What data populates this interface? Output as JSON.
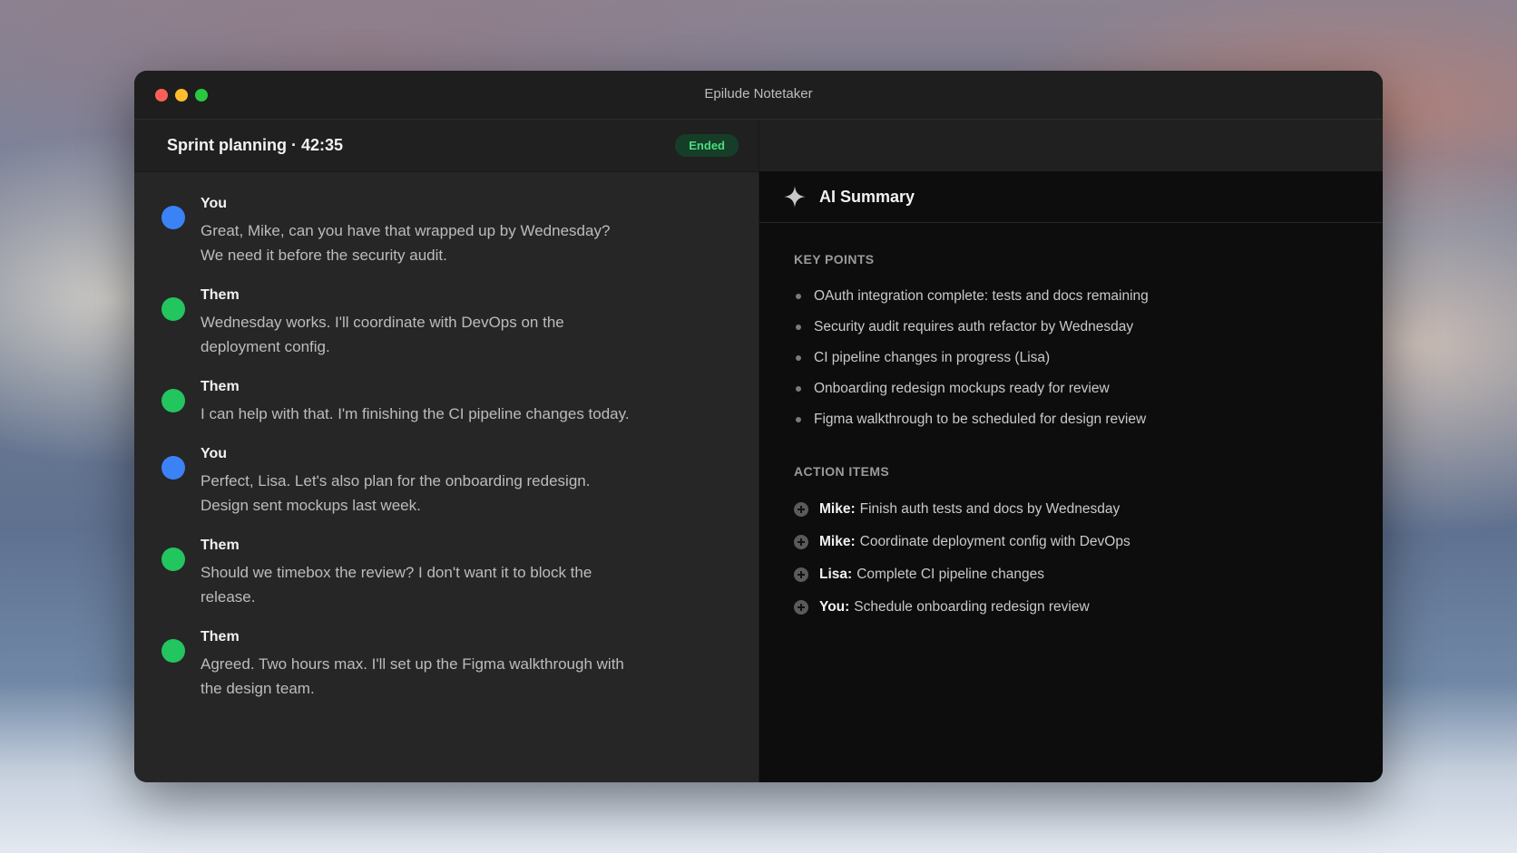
{
  "window": {
    "title": "Epilude Notetaker"
  },
  "session": {
    "title": "Sprint planning · 42:35",
    "status": "Ended",
    "status_color": "#4ade80"
  },
  "transcript": [
    {
      "speaker": "You",
      "avatar_color": "#3b82f6",
      "text": "Great, Mike, can you have that wrapped up by Wednesday? We need it before the security audit."
    },
    {
      "speaker": "Them",
      "avatar_color": "#22c55e",
      "text": "Wednesday works. I'll coordinate with DevOps on the deployment config."
    },
    {
      "speaker": "Them",
      "avatar_color": "#22c55e",
      "text": "I can help with that. I'm finishing the CI pipeline changes today."
    },
    {
      "speaker": "You",
      "avatar_color": "#3b82f6",
      "text": "Perfect, Lisa. Let's also plan for the onboarding redesign. Design sent mockups last week."
    },
    {
      "speaker": "Them",
      "avatar_color": "#22c55e",
      "text": "Should we timebox the review? I don't want it to block the release."
    },
    {
      "speaker": "Them",
      "avatar_color": "#22c55e",
      "text": "Agreed. Two hours max. I'll set up the Figma walkthrough with the design team."
    }
  ],
  "summary": {
    "title": "AI Summary",
    "icon": "sparkle-icon",
    "key_points_title": "KEY POINTS",
    "key_points": [
      "OAuth integration complete: tests and docs remaining",
      "Security audit requires auth refactor by Wednesday",
      "CI pipeline changes in progress (Lisa)",
      "Onboarding redesign mockups ready for review",
      "Figma walkthrough to be scheduled for design review"
    ],
    "action_items_title": "ACTION ITEMS",
    "action_items": [
      {
        "owner": "Mike:",
        "task": "Finish auth tests and docs by Wednesday"
      },
      {
        "owner": "Mike:",
        "task": "Coordinate deployment config with DevOps"
      },
      {
        "owner": "Lisa:",
        "task": "Complete CI pipeline changes"
      },
      {
        "owner": "You:",
        "task": "Schedule onboarding redesign review"
      }
    ]
  }
}
